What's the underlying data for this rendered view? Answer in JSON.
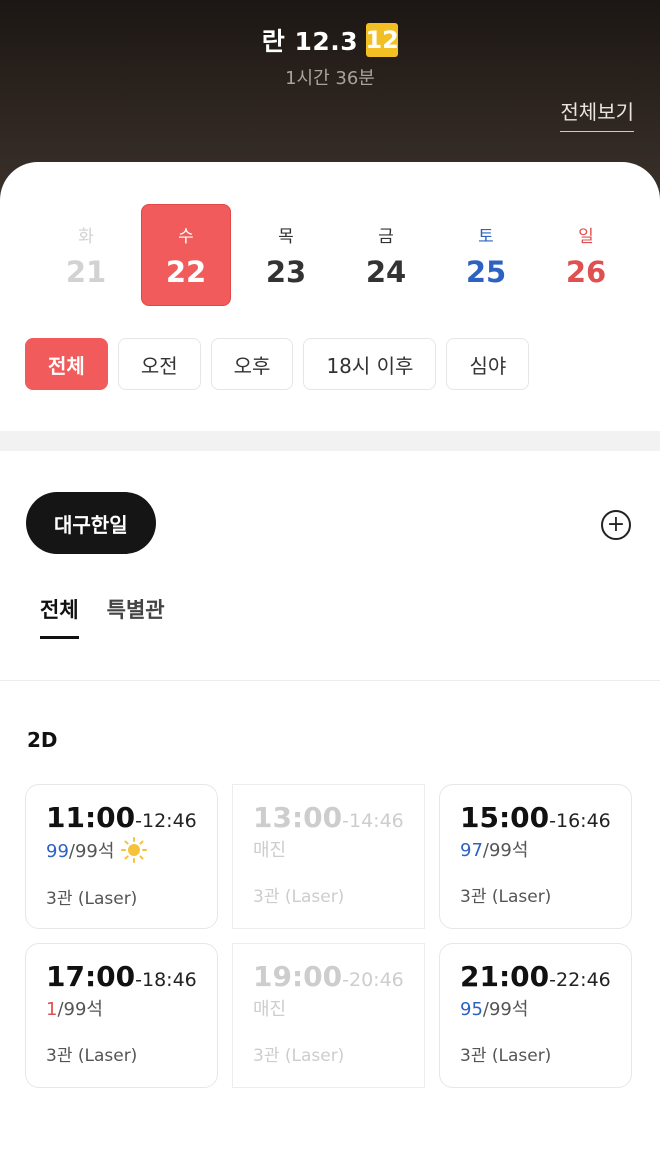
{
  "movie": {
    "title": "란 12.3",
    "rating": "12",
    "runtime": "1시간 36분",
    "view_all": "전체보기"
  },
  "dates": [
    {
      "dow": "화",
      "day": "21",
      "state": "past"
    },
    {
      "dow": "수",
      "day": "22",
      "state": "selected"
    },
    {
      "dow": "목",
      "day": "23",
      "state": "normal"
    },
    {
      "dow": "금",
      "day": "24",
      "state": "normal"
    },
    {
      "dow": "토",
      "day": "25",
      "state": "saturday"
    },
    {
      "dow": "일",
      "day": "26",
      "state": "sunday"
    }
  ],
  "filters": [
    "전체",
    "오전",
    "오후",
    "18시 이후",
    "심야"
  ],
  "theater": {
    "name": "대구한일",
    "add_icon": "plus-circle-icon"
  },
  "tabs": [
    "전체",
    "특별관"
  ],
  "format": "2D",
  "showtimes": [
    {
      "start": "11:00",
      "end": "-12:46",
      "available": "99",
      "total": "/99석",
      "hall": "3관 (Laser)",
      "icon": "sun-icon"
    },
    {
      "start": "13:00",
      "end": "-14:46",
      "status": "매진",
      "hall": "3관 (Laser)"
    },
    {
      "start": "15:00",
      "end": "-16:46",
      "available": "97",
      "total": "/99석",
      "hall": "3관 (Laser)"
    },
    {
      "start": "17:00",
      "end": "-18:46",
      "available": "1",
      "total": "/99석",
      "hall": "3관 (Laser)"
    },
    {
      "start": "19:00",
      "end": "-20:46",
      "status": "매진",
      "hall": "3관 (Laser)"
    },
    {
      "start": "21:00",
      "end": "-22:46",
      "available": "95",
      "total": "/99석",
      "hall": "3관 (Laser)"
    }
  ],
  "colors": {
    "accent": "#f15b5b",
    "saturday": "#2e62c2",
    "sunday": "#e05050",
    "rating_badge": "#f2c024"
  }
}
